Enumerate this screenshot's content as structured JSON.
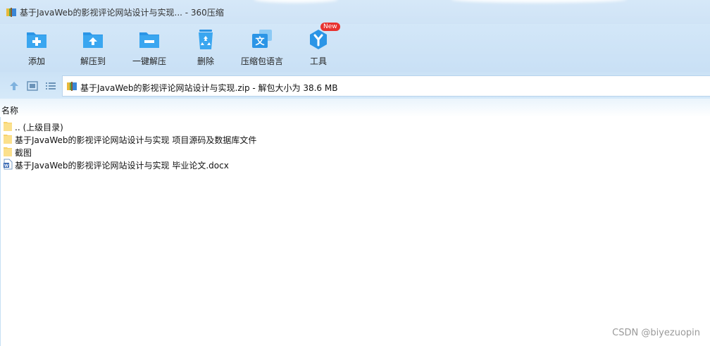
{
  "window": {
    "title": "基于JavaWeb的影视评论网站设计与实现... - 360压缩"
  },
  "toolbar": {
    "items": [
      {
        "label": "添加",
        "icon": "add-icon"
      },
      {
        "label": "解压到",
        "icon": "extract-to-icon"
      },
      {
        "label": "一键解压",
        "icon": "one-click-extract-icon"
      },
      {
        "label": "删除",
        "icon": "recycle-bin-icon"
      },
      {
        "label": "压缩包语言",
        "icon": "language-icon"
      },
      {
        "label": "工具",
        "icon": "tools-icon"
      }
    ],
    "new_badge": "New"
  },
  "address": {
    "text": "基于JavaWeb的影视评论网站设计与实现.zip - 解包大小为 38.6 MB"
  },
  "list": {
    "column_name": "名称",
    "rows": [
      {
        "name": ".. (上级目录)",
        "type": "folder"
      },
      {
        "name": "基于JavaWeb的影视评论网站设计与实现 项目源码及数据库文件",
        "type": "folder"
      },
      {
        "name": "截图",
        "type": "folder"
      },
      {
        "name": "基于JavaWeb的影视评论网站设计与实现 毕业论文.docx",
        "type": "docx"
      }
    ]
  },
  "watermark": "CSDN @biyezuopin",
  "colors": {
    "accent": "#1e8fe0",
    "toolbar_bg": "#cfe3f6",
    "folder": "#f7d26b",
    "badge": "#e8322f"
  }
}
